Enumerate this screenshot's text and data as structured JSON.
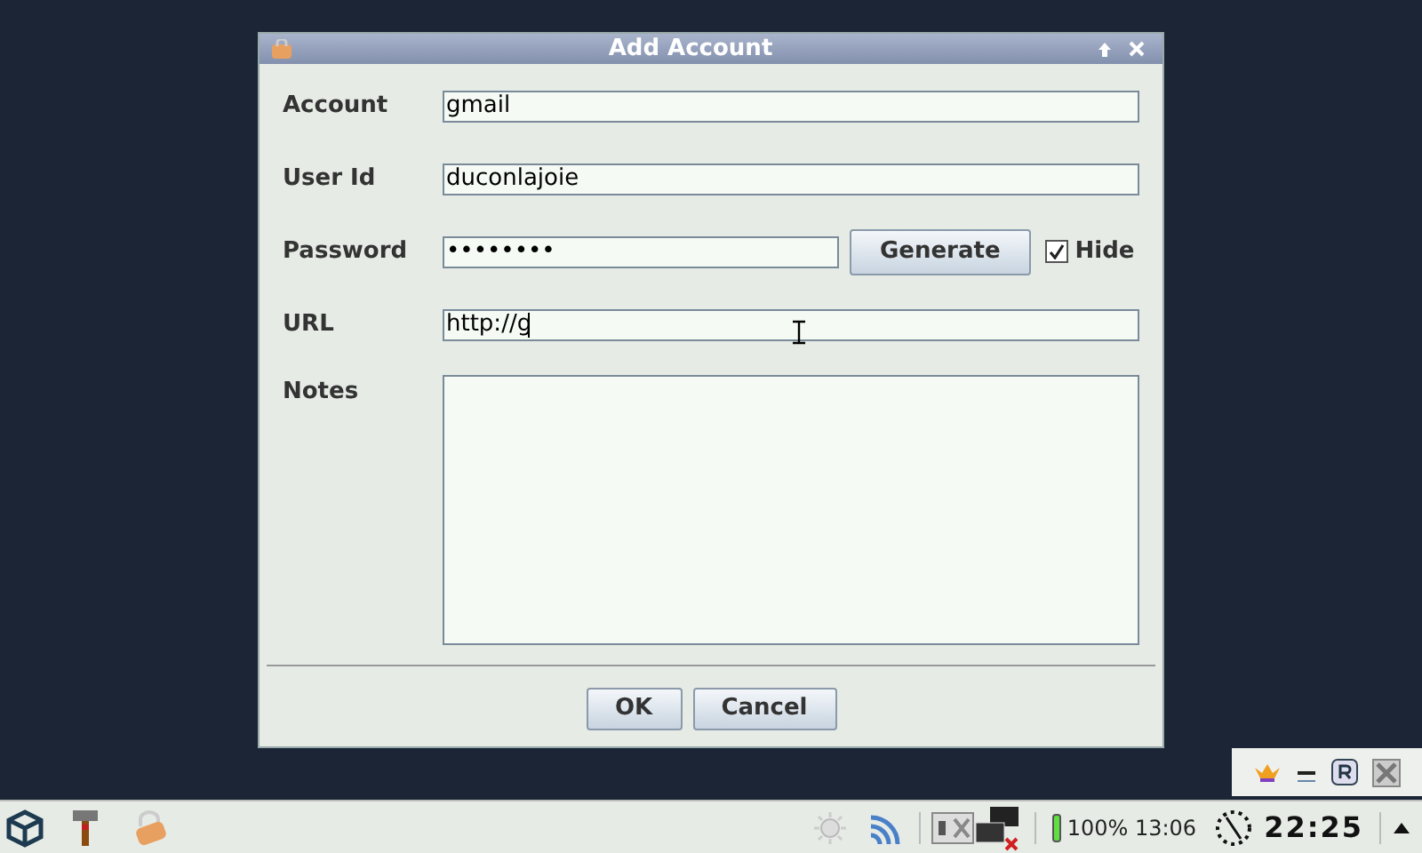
{
  "window": {
    "title": "Add Account"
  },
  "form": {
    "fields": [
      {
        "kind": "text",
        "label": "Account",
        "value": "gmail"
      },
      {
        "kind": "text",
        "label": "User Id",
        "value": "duconlajoie"
      },
      {
        "kind": "password",
        "label": "Password",
        "value": "••••••••",
        "button": "Generate",
        "checkbox": {
          "label": "Hide",
          "checked": true
        }
      },
      {
        "kind": "text",
        "label": "URL",
        "value": "http://g",
        "focused": true
      },
      {
        "kind": "area",
        "label": "Notes"
      }
    ]
  },
  "buttons": [
    "OK",
    "Cancel"
  ],
  "clock": {
    "battery": "100% 13:06",
    "time": "22:25"
  }
}
